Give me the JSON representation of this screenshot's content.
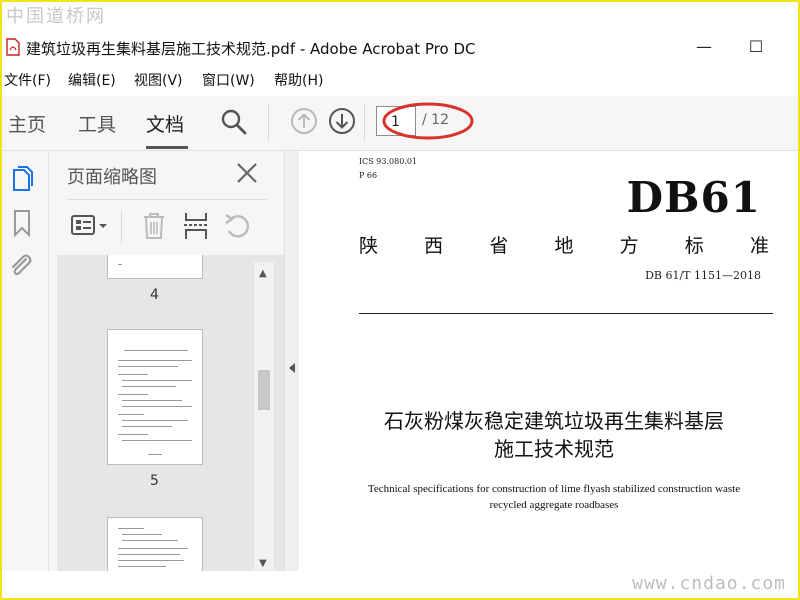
{
  "watermark": {
    "top": "中国道桥网",
    "bottom": "www.cndao.com"
  },
  "window": {
    "title": "建筑垃圾再生集料基层施工技术规范.pdf - Adobe Acrobat Pro DC",
    "controls": {
      "minimize": "—",
      "maximize": "☐"
    }
  },
  "menu": [
    "文件(F)",
    "编辑(E)",
    "视图(V)",
    "窗口(W)",
    "帮助(H)"
  ],
  "toolbar": {
    "tabs": [
      "主页",
      "工具",
      "文档"
    ],
    "active_tab": "文档",
    "page_current": "1",
    "page_total": "/ 12"
  },
  "sidebar": {
    "icons": [
      "pages-icon",
      "bookmark-icon",
      "attachment-icon"
    ]
  },
  "thumbnail_panel": {
    "title": "页面缩略图",
    "pages": [
      {
        "number": "4"
      },
      {
        "number": "5"
      }
    ]
  },
  "document": {
    "ics": "ICS 93.080.01",
    "p_code": "P 66",
    "standard": "DB61",
    "province": [
      "陕",
      "西",
      "省",
      "地",
      "方",
      "标",
      "准"
    ],
    "code": "DB 61/T 1151—2018",
    "title_line1": "石灰粉煤灰稳定建筑垃圾再生集料基层",
    "title_line2": "施工技术规范",
    "english_line1": "Technical specifications for construction of lime flyash stabilized construction waste",
    "english_line2": "recycled aggregate roadbases"
  },
  "colors": {
    "frame": "#f2e21c",
    "highlight_oval": "#d9322b",
    "pdf_red": "#c8201f"
  }
}
